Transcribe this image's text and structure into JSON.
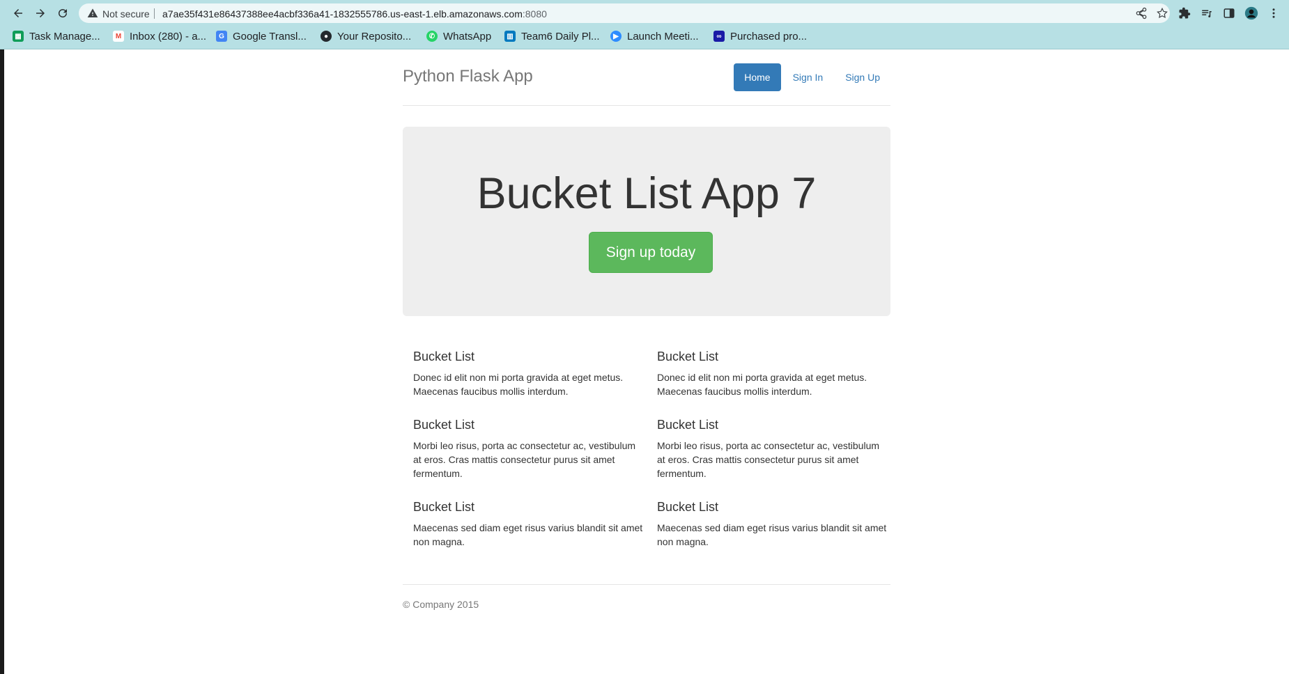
{
  "browser": {
    "not_secure": "Not secure",
    "url_host": "a7ae35f431e86437388ee4acbf336a41-1832555786.us-east-1.elb.amazonaws.com",
    "url_port": ":8080",
    "bookmarks": [
      {
        "label": "Task Manage...",
        "icon": "sheets-icon",
        "color": "#0f9d58"
      },
      {
        "label": "Inbox (280) - a...",
        "icon": "gmail-icon",
        "color": "#ea4335"
      },
      {
        "label": "Google Transl...",
        "icon": "translate-icon",
        "color": "#4285f4"
      },
      {
        "label": "Your Reposito...",
        "icon": "github-icon",
        "color": "#24292e"
      },
      {
        "label": "WhatsApp",
        "icon": "whatsapp-icon",
        "color": "#25d366"
      },
      {
        "label": "Team6 Daily Pl...",
        "icon": "trello-icon",
        "color": "#0079bf"
      },
      {
        "label": "Launch Meeti...",
        "icon": "zoom-icon",
        "color": "#2d8cff"
      },
      {
        "label": "Purchased pro...",
        "icon": "purchased-icon",
        "color": "#1a1aa6"
      }
    ]
  },
  "header": {
    "brand": "Python Flask App",
    "nav": [
      "Home",
      "Sign In",
      "Sign Up"
    ]
  },
  "jumbotron": {
    "title": "Bucket List App 7",
    "button": "Sign up today"
  },
  "marketing": {
    "left": [
      {
        "heading": "Bucket List",
        "text": "Donec id elit non mi porta gravida at eget metus. Maecenas faucibus mollis interdum."
      },
      {
        "heading": "Bucket List",
        "text": "Morbi leo risus, porta ac consectetur ac, vestibulum at eros. Cras mattis consectetur purus sit amet fermentum."
      },
      {
        "heading": "Bucket List",
        "text": "Maecenas sed diam eget risus varius blandit sit amet non magna."
      }
    ],
    "right": [
      {
        "heading": "Bucket List",
        "text": "Donec id elit non mi porta gravida at eget metus. Maecenas faucibus mollis interdum."
      },
      {
        "heading": "Bucket List",
        "text": "Morbi leo risus, porta ac consectetur ac, vestibulum at eros. Cras mattis consectetur purus sit amet fermentum."
      },
      {
        "heading": "Bucket List",
        "text": "Maecenas sed diam eget risus varius blandit sit amet non magna."
      }
    ]
  },
  "footer": {
    "copyright": "© Company 2015"
  },
  "colors": {
    "chrome_bg": "#b7e0e4",
    "primary": "#337ab7",
    "success": "#5cb85c",
    "jumbotron_bg": "#eeeeee"
  }
}
